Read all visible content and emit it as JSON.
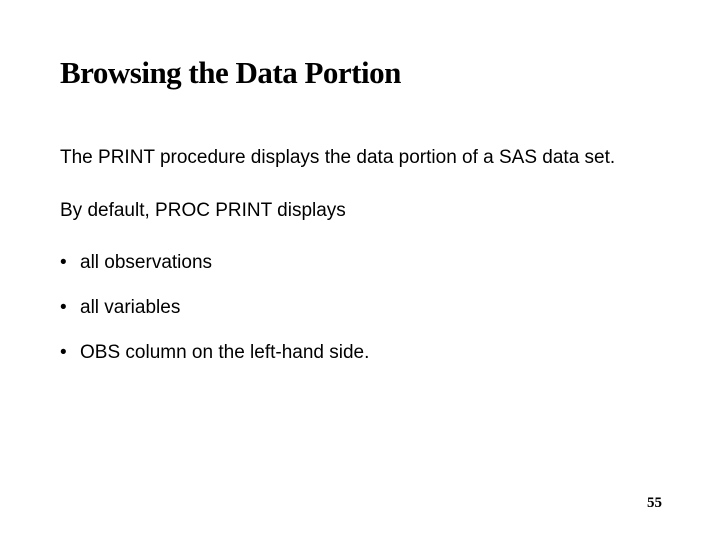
{
  "title": "Browsing the Data Portion",
  "para1": "The PRINT procedure displays the data portion of a SAS data set.",
  "para2": "By default, PROC PRINT displays",
  "bullets": [
    "all observations",
    "all variables",
    "OBS column on the left-hand side."
  ],
  "pageNumber": "55"
}
